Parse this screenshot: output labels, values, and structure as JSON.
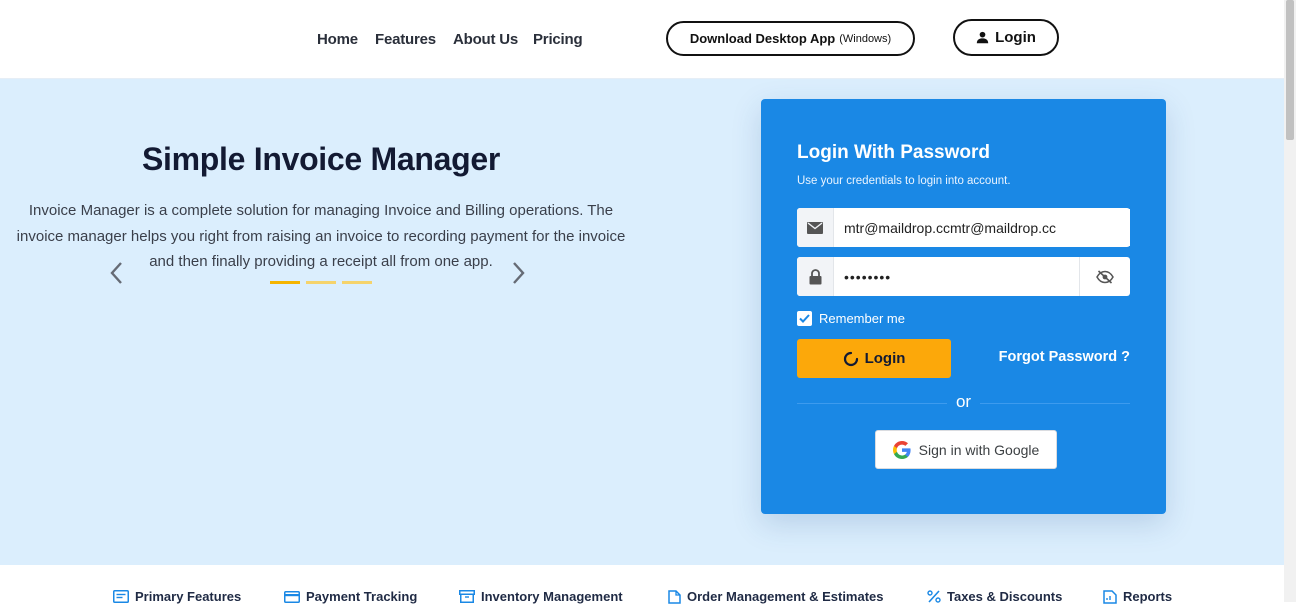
{
  "nav": {
    "links": [
      "Home",
      "Features",
      "About Us",
      "Pricing"
    ],
    "download_label": "Download Desktop App",
    "download_platform": "(Windows)",
    "login_label": "Login"
  },
  "hero": {
    "title": "Simple Invoice Manager",
    "description": "Invoice Manager is a complete solution for managing Invoice and Billing operations. The invoice manager helps you right from raising an invoice to recording payment for the invoice and then finally providing a receipt all from one app.",
    "carousel": {
      "slides": 3,
      "active_index": 0
    }
  },
  "login_form": {
    "title": "Login With Password",
    "subtitle": "Use your credentials to login into account.",
    "email_value": "mtr@maildrop.ccmtr@maildrop.cc",
    "password_value": "••••••••",
    "remember_label": "Remember me",
    "remember_checked": true,
    "submit_label": "Login",
    "forgot_label": "Forgot Password ?",
    "or_label": "or",
    "google_label": "Sign in with Google"
  },
  "feature_tabs": [
    {
      "label": "Primary Features",
      "icon": "list-icon"
    },
    {
      "label": "Payment Tracking",
      "icon": "credit-card-icon"
    },
    {
      "label": "Inventory Management",
      "icon": "archive-icon"
    },
    {
      "label": "Order Management & Estimates",
      "icon": "document-icon"
    },
    {
      "label": "Taxes & Discounts",
      "icon": "percent-icon"
    },
    {
      "label": "Reports",
      "icon": "report-icon"
    }
  ],
  "colors": {
    "hero_bg": "#dbeefd",
    "card_bg": "#1a88e5",
    "login_button": "#fca80a",
    "indicator_active": "#f5b400"
  }
}
